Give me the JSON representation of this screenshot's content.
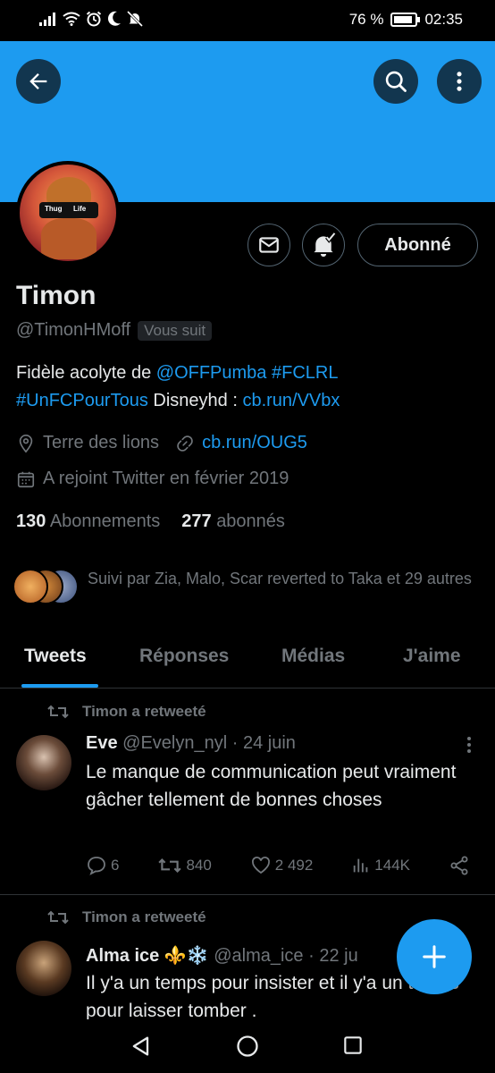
{
  "status_bar": {
    "battery_text": "76 %",
    "time": "02:35",
    "icons": [
      "signal-icon",
      "wifi-icon",
      "alarm-icon",
      "moon-icon",
      "mute-icon"
    ]
  },
  "header": {
    "banner_color": "#1d9bf0",
    "back_icon": "arrow-left-icon",
    "search_icon": "search-icon",
    "more_icon": "more-vertical-icon"
  },
  "profile": {
    "name": "Timon",
    "handle": "@TimonHMoff",
    "follows_you": "Vous suit",
    "bio_part1": "Fidèle acolyte de ",
    "bio_mention": "@OFFPumba",
    "bio_space": " ",
    "bio_hashtag1": "#FCLRL",
    "bio_hashtag2": "#UnFCPourTous",
    "bio_text2": " Disneyhd : ",
    "bio_link": "cb.run/VVbx",
    "location": "Terre des lions",
    "website": "cb.run/OUG5",
    "joined": "A rejoint Twitter en février 2019",
    "following_count": "130",
    "following_label": "Abonnements",
    "followers_count": "277",
    "followers_label": "abonnés",
    "followed_by": "Suivi par Zia, Malo, Scar reverted to Taka et 29 autres",
    "follow_button": "Abonné",
    "avatar_text_left": "Thug",
    "avatar_text_right": "Life"
  },
  "tabs": [
    {
      "label": "Tweets",
      "active": true
    },
    {
      "label": "Réponses",
      "active": false
    },
    {
      "label": "Médias",
      "active": false
    },
    {
      "label": "J'aime",
      "active": false
    }
  ],
  "tweets": [
    {
      "retweet_label": "Timon a retweeté",
      "author": "Eve",
      "handle": "@Evelyn_nyl",
      "date": " · 24 juin",
      "text": "Le manque de communication peut vraiment gâcher tellement de bonnes choses",
      "replies": "6",
      "retweets": "840",
      "likes": "2 492",
      "views": "144K"
    },
    {
      "retweet_label": "Timon a retweeté",
      "author": "Alma ice ⚜️❄️",
      "handle": "@alma_ice",
      "date": " · 22 ju",
      "text": "Il y'a un temps pour insister et il y'a un temps pour laisser tomber ."
    }
  ],
  "colors": {
    "accent": "#1d9bf0",
    "background": "#000000",
    "text": "#e7e9ea",
    "muted": "#71767b",
    "border": "#2f3336"
  }
}
